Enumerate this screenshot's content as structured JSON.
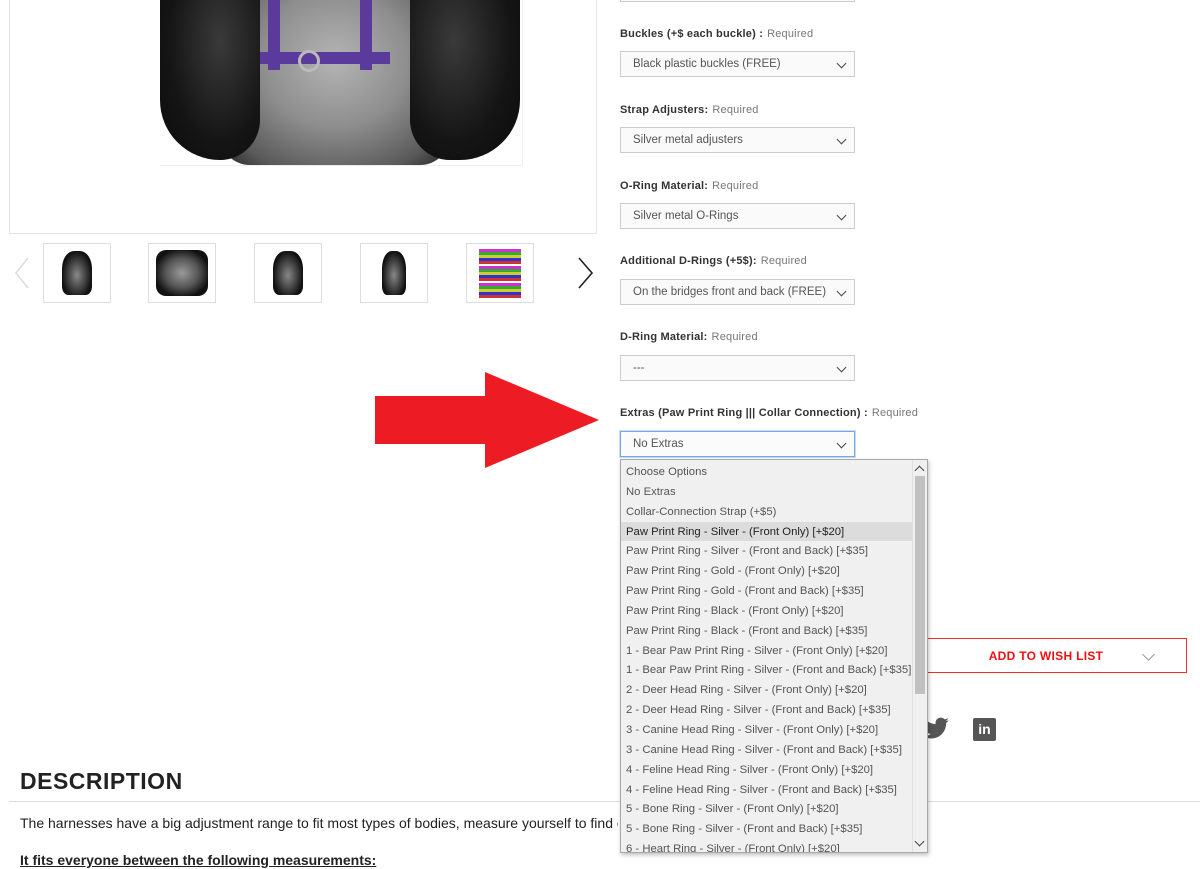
{
  "options": [
    {
      "label": "Buckles (+$ each buckle) :",
      "required": "Required",
      "value": "Black plastic buckles (FREE)"
    },
    {
      "label": "Strap Adjusters:",
      "required": "Required",
      "value": "Silver metal adjusters"
    },
    {
      "label": "O-Ring Material:",
      "required": "Required",
      "value": "Silver metal O-Rings"
    },
    {
      "label": "Additional D-Rings (+5$):",
      "required": "Required",
      "value": "On the bridges front and back (FREE)"
    },
    {
      "label": "D-Ring Material:",
      "required": "Required",
      "value": "---"
    },
    {
      "label": "Extras (Paw Print Ring ||| Collar Connection) :",
      "required": "Required",
      "value": "No Extras"
    }
  ],
  "extras_dropdown": {
    "items": [
      "Choose Options",
      "No Extras",
      "Collar-Connection Strap (+$5)",
      "Paw Print Ring - Silver - (Front Only) [+$20]",
      "Paw Print Ring - Silver - (Front and Back) [+$35]",
      "Paw Print Ring - Gold - (Front Only) [+$20]",
      "Paw Print Ring - Gold - (Front and Back) [+$35]",
      "Paw Print Ring - Black - (Front Only) [+$20]",
      "Paw Print Ring - Black - (Front and Back) [+$35]",
      "1 - Bear Paw Print Ring - Silver - (Front Only) [+$20]",
      "1 - Bear Paw Print Ring - Silver - (Front and Back) [+$35]",
      "2 - Deer Head Ring - Silver - (Front Only) [+$20]",
      "2 - Deer Head Ring - Silver - (Front and Back) [+$35]",
      "3 - Canine Head Ring - Silver - (Front Only) [+$20]",
      "3 - Canine Head Ring - Silver - (Front and Back) [+$35]",
      "4 - Feline Head Ring - Silver - (Front Only) [+$20]",
      "4 - Feline Head Ring - Silver - (Front and Back) [+$35]",
      "5 - Bone Ring - Silver - (Front Only) [+$20]",
      "5 - Bone Ring - Silver - (Front and Back) [+$35]",
      "6 - Heart Ring - Silver - (Front Only) [+$20]"
    ],
    "highlighted_index": 3
  },
  "wishlist": {
    "label": "ADD TO WISH LIST"
  },
  "social": {
    "twitter_icon": "twitter-icon",
    "linkedin_icon": "linkedin-icon",
    "linkedin_text": "in"
  },
  "description": {
    "title": "DESCRIPTION",
    "text": "The harnesses have a big adjustment range to fit most types of bodies, measure yourself to find out w",
    "subheading": "It fits everyone between the following measurements:"
  },
  "colors": {
    "accent_red": "#e11d1d",
    "arrow_red": "#ed1c24",
    "harness_purple": "#5a3a9a"
  }
}
